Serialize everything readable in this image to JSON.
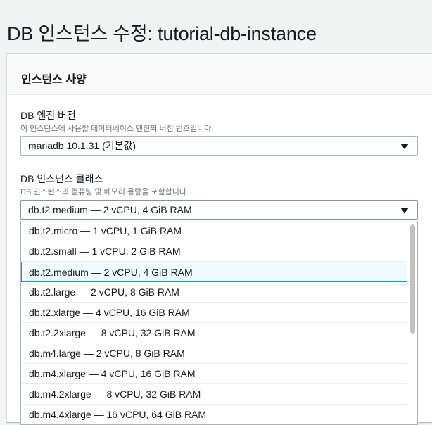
{
  "page": {
    "title": "DB 인스턴스 수정: tutorial-db-instance"
  },
  "panel": {
    "title": "인스턴스 사양"
  },
  "engine_version": {
    "label": "DB 엔진 버전",
    "description": "이 인스턴스에 사용할 데이터베이스 엔진의 버전 번호입니다.",
    "value": "mariadb 10.1.31 (기본값)"
  },
  "instance_class": {
    "label": "DB 인스턴스 클래스",
    "description": "DB 인스턴스의 컴퓨팅 및 메모리 용량을 포함합니다.",
    "value": "db.t2.medium — 2 vCPU, 4 GiB RAM",
    "options": [
      {
        "label": "db.t2.micro — 1 vCPU, 1 GiB RAM"
      },
      {
        "label": "db.t2.small — 1 vCPU, 2 GiB RAM"
      },
      {
        "label": "db.t2.medium — 2 vCPU, 4 GiB RAM",
        "selected": true
      },
      {
        "label": "db.t2.large — 2 vCPU, 8 GiB RAM"
      },
      {
        "label": "db.t2.xlarge — 4 vCPU, 16 GiB RAM"
      },
      {
        "label": "db.t2.2xlarge — 8 vCPU, 32 GiB RAM"
      },
      {
        "label": "db.m4.large — 2 vCPU, 8 GiB RAM"
      },
      {
        "label": "db.m4.xlarge — 4 vCPU, 16 GiB RAM"
      },
      {
        "label": "db.m4.2xlarge — 8 vCPU, 32 GiB RAM"
      },
      {
        "label": "db.m4.4xlarge — 16 vCPU, 64 GiB RAM"
      }
    ]
  },
  "icons": {
    "caret": "caret-down-icon"
  },
  "colors": {
    "selected_border": "#00a1c9",
    "selected_bg": "#f1faff"
  }
}
